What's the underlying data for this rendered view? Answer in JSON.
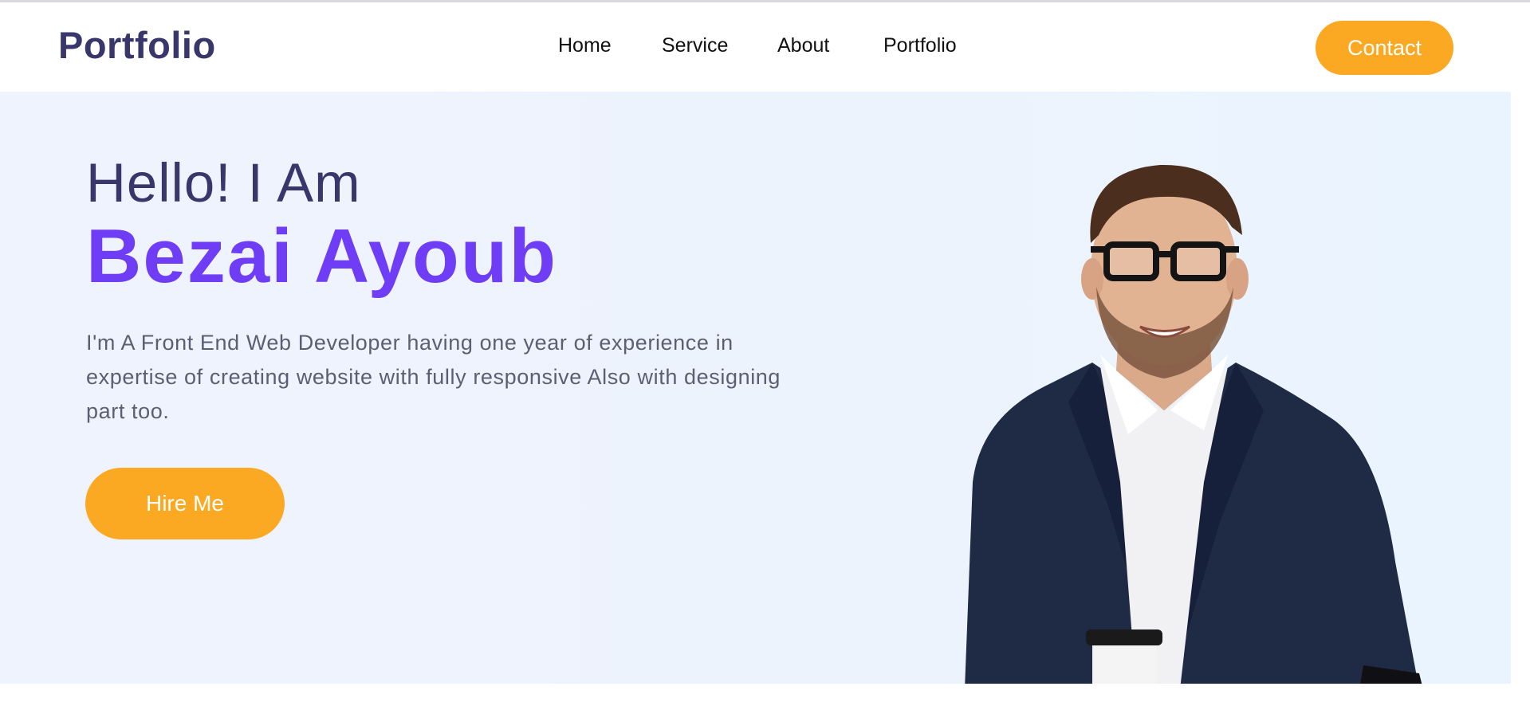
{
  "header": {
    "logo": "Portfolio",
    "nav": {
      "home": "Home",
      "service": "Service",
      "about": "About",
      "portfolio": "Portfolio"
    },
    "contact_label": "Contact"
  },
  "hero": {
    "greeting": "Hello! I Am",
    "name": "Bezai Ayoub",
    "bio": "I'm A Front End Web Developer having one year of experience in expertise of creating website with fully responsive Also with designing part too.",
    "hire_label": "Hire Me"
  },
  "colors": {
    "brand_dark": "#38366a",
    "accent_purple": "#6e3df5",
    "button_orange": "#fba923",
    "hero_background": "#edf3fd"
  }
}
